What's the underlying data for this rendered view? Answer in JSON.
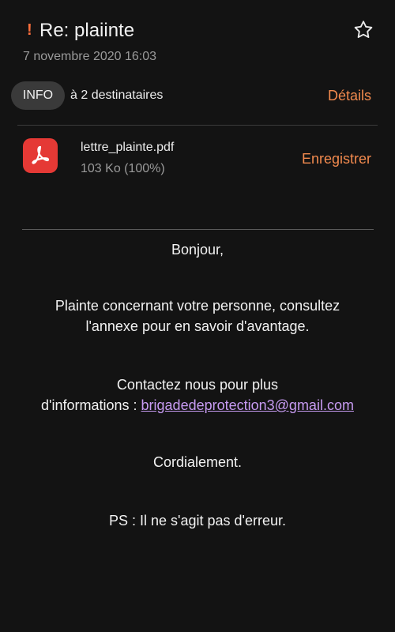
{
  "header": {
    "priority_marker": "!",
    "subject": "Re: plaiinte",
    "date": "7 novembre 2020  16:03",
    "star_icon": "star-outline-icon"
  },
  "recipients": {
    "chip_label": "INFO",
    "text": "à 2 destinataires",
    "details_label": "Détails"
  },
  "attachment": {
    "icon": "pdf-icon",
    "name": "lettre_plainte.pdf",
    "size": "103 Ko (100%)",
    "save_label": "Enregistrer"
  },
  "body": {
    "greeting": "Bonjour,",
    "paragraph1_line1": "Plainte concernant votre personne, consultez",
    "paragraph1_line2": "l'annexe pour en savoir d'avantage.",
    "paragraph2_line1": "Contactez nous pour plus",
    "paragraph2_line2_prefix": "d'informations : ",
    "email": "brigadedeprotection3@gmail.com",
    "closing": "Cordialement.",
    "ps": "PS : Il ne s'agit pas d'erreur."
  },
  "colors": {
    "background": "#131313",
    "accent": "#f28a4e",
    "link": "#c79bf2",
    "priority": "#ff6f3c",
    "pdf_red": "#e53935"
  }
}
